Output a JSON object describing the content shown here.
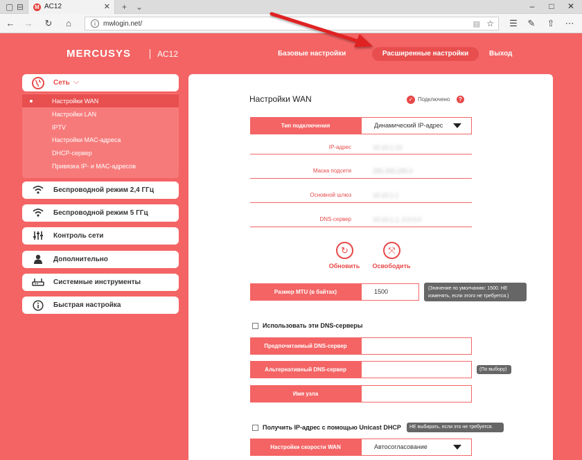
{
  "browser": {
    "tab_title": "AC12",
    "tab_favicon": "M",
    "url": "mwlogin.net/"
  },
  "header": {
    "brand": "MERCUSYS",
    "model": "AC12",
    "nav": {
      "basic": "Базовые настройки",
      "advanced": "Расширенные настройки",
      "exit": "Выход"
    }
  },
  "sidebar": {
    "network": {
      "label": "Сеть",
      "items": [
        {
          "label": "Настройки WAN",
          "active": true
        },
        {
          "label": "Настройки LAN"
        },
        {
          "label": "IPTV"
        },
        {
          "label": "Настройки MAC-адреса"
        },
        {
          "label": "DHCP-сервер"
        },
        {
          "label": "Привязка IP- и MAC-адресов"
        }
      ]
    },
    "items": [
      {
        "label": "Беспроводной режим 2,4 ГГц",
        "icon": "wifi-icon"
      },
      {
        "label": "Беспроводной режим 5 ГГц",
        "icon": "wifi-icon"
      },
      {
        "label": "Контроль сети",
        "icon": "sliders-icon"
      },
      {
        "label": "Дополнительно",
        "icon": "user-icon"
      },
      {
        "label": "Системные инструменты",
        "icon": "router-icon"
      },
      {
        "label": "Быстрая настройка",
        "icon": "info-icon"
      }
    ]
  },
  "panel": {
    "title": "Настройки WAN",
    "status": "Подключено",
    "connection_type_label": "Тип подключения",
    "connection_type_value": "Динамический IP-адрес",
    "fields": [
      {
        "label": "IP-адрес",
        "value": "10.10.1.10"
      },
      {
        "label": "Маска подсети",
        "value": "255.255.255.0"
      },
      {
        "label": "Основной шлюз",
        "value": "10.10.1.1"
      },
      {
        "label": "DNS-сервер",
        "value": "10.10.1.1, 0.0.0.0"
      }
    ],
    "renew": "Обновить",
    "release": "Освободить",
    "mtu_label": "Размер MTU (в байтах)",
    "mtu_value": "1500",
    "mtu_tip": "(Значение по умолчанию: 1500. НЕ изменять, если этого не требуется.)",
    "use_dns_label": "Использовать эти DNS-серверы",
    "preferred_dns_label": "Предпочитаемый DNS-сервер",
    "alternate_dns_label": "Альтернативный DNS-сервер",
    "optional_tip": "(По выбору)",
    "host_name_label": "Имя узла",
    "unicast_label": "Получить IP-адрес с помощью Unicast DHCP",
    "unicast_tip": "НЕ выбирать, если это не требуется.",
    "wan_speed_label": "Настройки скорости WAN",
    "wan_speed_value": "Автосогласование"
  },
  "colors": {
    "accent": "#f46464",
    "accent_dark": "#e84848"
  }
}
